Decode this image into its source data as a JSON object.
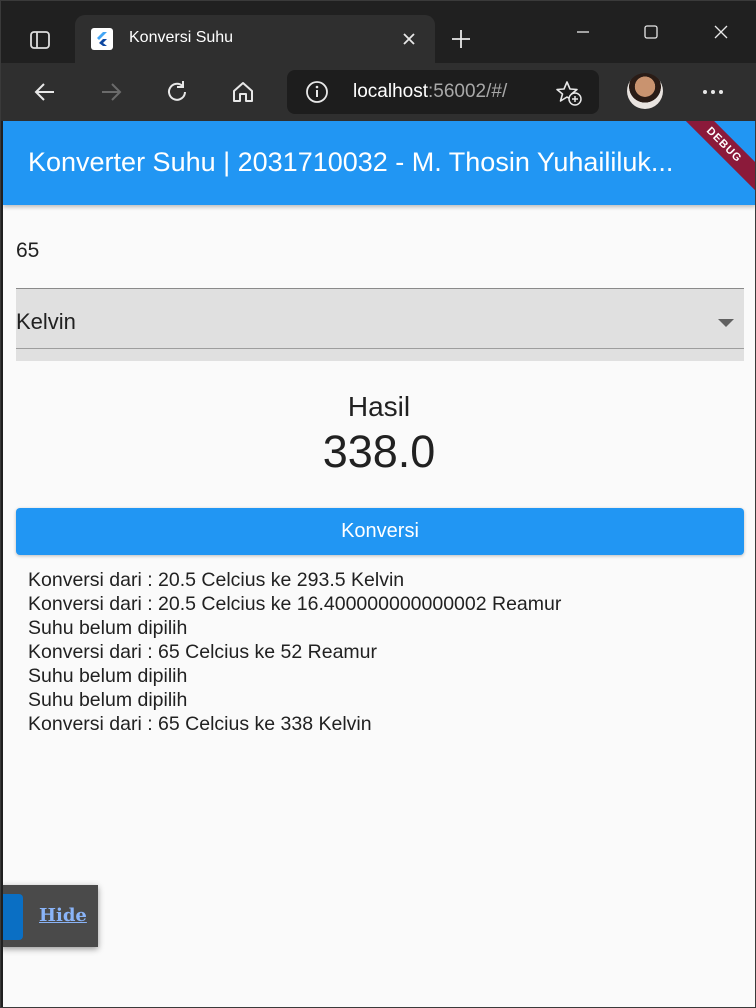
{
  "browser": {
    "tab_title": "Konversi Suhu",
    "address_host": "localhost",
    "address_rest": ":56002/#/"
  },
  "app": {
    "title": "Konverter Suhu | 2031710032 - M. Thosin Yuhaililuk...",
    "debug_banner": "DEBUG",
    "input_value": "65",
    "dropdown_selected": "Kelvin",
    "result_label": "Hasil",
    "result_value": "338.0",
    "convert_button": "Konversi",
    "history": [
      "Konversi dari : 20.5 Celcius ke 293.5 Kelvin",
      "Konversi dari : 20.5 Celcius ke 16.400000000000002 Reamur",
      "Suhu belum dipilih",
      "Konversi dari : 65 Celcius ke 52 Reamur",
      "Suhu belum dipilih",
      "Suhu belum dipilih",
      "Konversi dari : 65 Celcius ke 338 Kelvin"
    ]
  },
  "toast": {
    "hide_label": "Hide"
  },
  "colors": {
    "primary": "#2196f3",
    "debug": "#8b1a3a"
  },
  "icons": {
    "tab_actions": "tab-actions-icon",
    "favicon": "flutter-icon",
    "close": "close-icon",
    "new_tab": "plus-icon",
    "minimize": "minimize-icon",
    "maximize": "maximize-icon",
    "window_close": "close-icon",
    "back": "back-arrow-icon",
    "forward": "forward-arrow-icon",
    "refresh": "refresh-icon",
    "home": "home-icon",
    "info": "info-icon",
    "favorites": "star-add-icon",
    "more": "more-icon"
  }
}
